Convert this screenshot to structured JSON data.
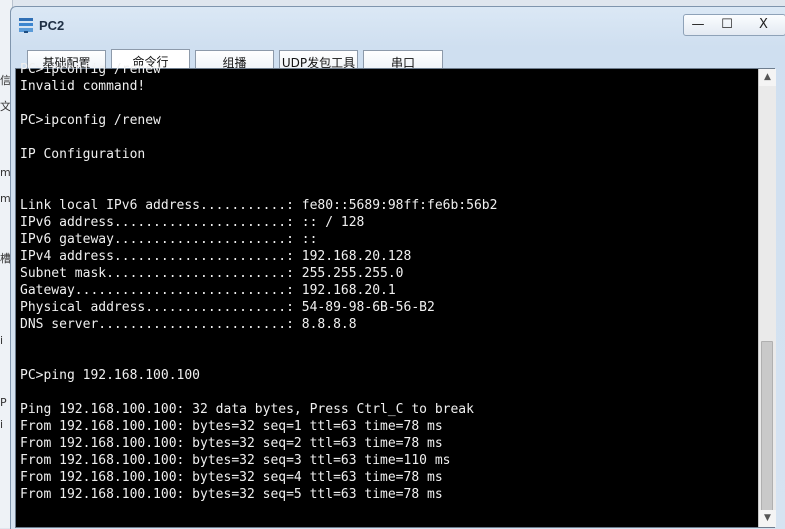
{
  "window": {
    "title": "PC2",
    "minimize_glyph": "—",
    "maximize_glyph": "☐",
    "close_glyph": "X"
  },
  "tabs": [
    {
      "label": "基础配置",
      "active": false
    },
    {
      "label": "命令行",
      "active": true
    },
    {
      "label": "组播",
      "active": false
    },
    {
      "label": "UDP发包工具",
      "active": false
    },
    {
      "label": "串口",
      "active": false
    }
  ],
  "terminal": {
    "lines": [
      "PC>ipconfig /renew",
      "Invalid command!",
      "",
      "PC>ipconfig /renew",
      "",
      "IP Configuration",
      "",
      "",
      "Link local IPv6 address...........: fe80::5689:98ff:fe6b:56b2",
      "IPv6 address......................: :: / 128",
      "IPv6 gateway......................: ::",
      "IPv4 address......................: 192.168.20.128",
      "Subnet mask.......................: 255.255.255.0",
      "Gateway...........................: 192.168.20.1",
      "Physical address..................: 54-89-98-6B-56-B2",
      "DNS server........................: 8.8.8.8",
      "",
      "",
      "PC>ping 192.168.100.100",
      "",
      "Ping 192.168.100.100: 32 data bytes, Press Ctrl_C to break",
      "From 192.168.100.100: bytes=32 seq=1 ttl=63 time=78 ms",
      "From 192.168.100.100: bytes=32 seq=2 ttl=63 time=78 ms",
      "From 192.168.100.100: bytes=32 seq=3 ttl=63 time=110 ms",
      "From 192.168.100.100: bytes=32 seq=4 ttl=63 time=78 ms",
      "From 192.168.100.100: bytes=32 seq=5 ttl=63 time=78 ms"
    ]
  },
  "background": {
    "left_fragments": [
      "信(",
      "文f",
      "m",
      "me",
      "槽",
      "i",
      "P",
      "i"
    ]
  },
  "colors": {
    "terminal_bg": "#000000",
    "terminal_fg": "#f0f0f0",
    "accent": "#4a7fc1"
  }
}
